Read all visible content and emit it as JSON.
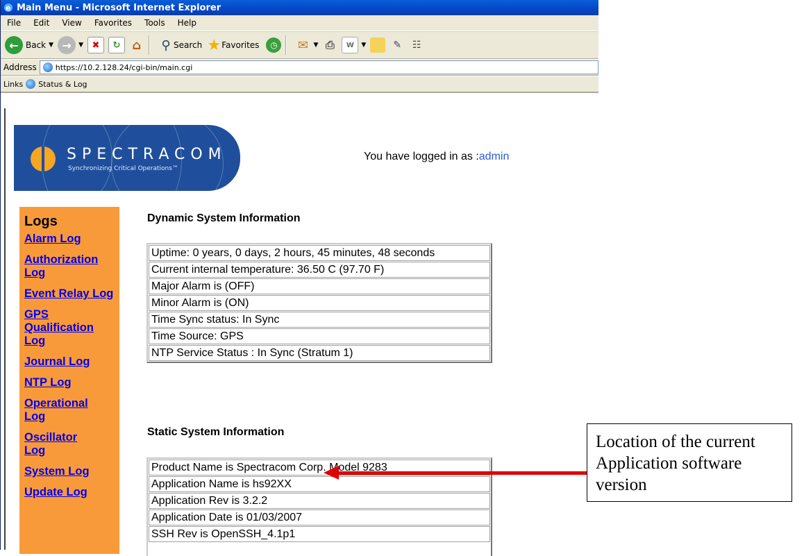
{
  "window": {
    "title": "Main Menu - Microsoft Internet Explorer"
  },
  "menu": [
    "File",
    "Edit",
    "View",
    "Favorites",
    "Tools",
    "Help"
  ],
  "toolbar": {
    "back_label": "Back",
    "search_label": "Search",
    "favorites_label": "Favorites"
  },
  "address": {
    "label": "Address",
    "url": "https://10.2.128.24/cgi-bin/main.cgi"
  },
  "links": {
    "label": "Links",
    "item": "Status & Log"
  },
  "header": {
    "brand": "SPECTRACOM",
    "tagline": "Synchronizing Critical Operations™",
    "login_prefix": "You have logged in as :",
    "login_user": "admin"
  },
  "sidebar": {
    "title": "Logs",
    "items": [
      "Alarm Log",
      "Authorization Log",
      "Event Relay Log",
      "GPS Qualification Log",
      "Journal Log",
      "NTP Log",
      "Operational Log",
      "Oscillator Log",
      "System Log",
      "Update Log"
    ]
  },
  "dynamic": {
    "heading": "Dynamic System Information",
    "rows": [
      "Uptime: 0 years, 0 days, 2 hours, 45 minutes, 48 seconds",
      "Current internal temperature: 36.50 C (97.70 F)",
      "Major Alarm is (OFF)",
      "Minor Alarm is (ON)",
      "Time Sync status: In Sync",
      "Time Source: GPS",
      "NTP Service Status : In Sync (Stratum 1)"
    ]
  },
  "static_info": {
    "heading": "Static System Information",
    "rows": [
      "Product Name is Spectracom Corp. Model 9283",
      "Application Name is hs92XX",
      "Application Rev is 3.2.2",
      "Application Date is 01/03/2007",
      "SSH Rev is OpenSSH_4.1p1"
    ]
  },
  "annotation": {
    "text": "Location of the current Application software version",
    "arrow_color": "#e00000"
  }
}
